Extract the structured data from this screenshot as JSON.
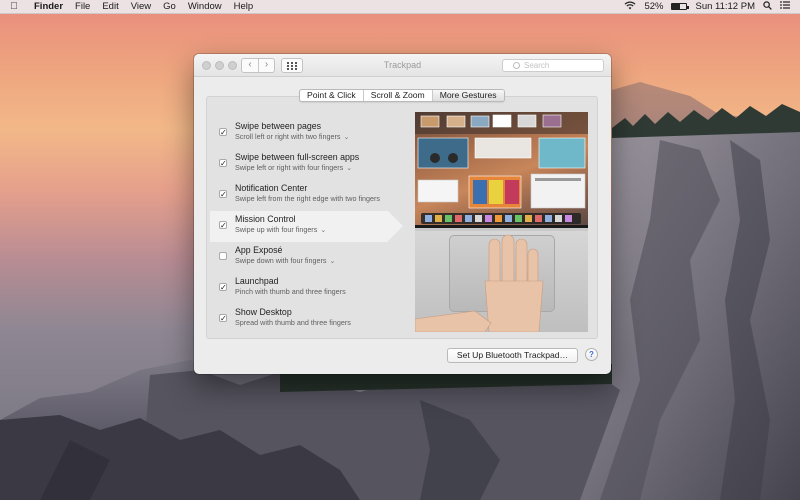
{
  "menubar": {
    "apple_icon": "apple-logo-icon",
    "app_name": "Finder",
    "menus": [
      "File",
      "Edit",
      "View",
      "Go",
      "Window",
      "Help"
    ],
    "battery_percent": "52%",
    "battery_level": 0.52,
    "clock": "Sun 11:12 PM"
  },
  "window": {
    "title": "Trackpad",
    "search_placeholder": "Search",
    "tabs": [
      {
        "label": "Point & Click",
        "active": false
      },
      {
        "label": "Scroll & Zoom",
        "active": false
      },
      {
        "label": "More Gestures",
        "active": true
      }
    ],
    "gestures": [
      {
        "title": "Swipe between pages",
        "subtitle": "Scroll left or right with two fingers",
        "has_menu": true,
        "checked": true,
        "selected": false
      },
      {
        "title": "Swipe between full-screen apps",
        "subtitle": "Swipe left or right with four fingers",
        "has_menu": true,
        "checked": true,
        "selected": false
      },
      {
        "title": "Notification Center",
        "subtitle": "Swipe left from the right edge with two fingers",
        "has_menu": false,
        "checked": true,
        "selected": false
      },
      {
        "title": "Mission Control",
        "subtitle": "Swipe up with four fingers",
        "has_menu": true,
        "checked": true,
        "selected": true
      },
      {
        "title": "App Exposé",
        "subtitle": "Swipe down with four fingers",
        "has_menu": true,
        "checked": false,
        "selected": false
      },
      {
        "title": "Launchpad",
        "subtitle": "Pinch with thumb and three fingers",
        "has_menu": false,
        "checked": true,
        "selected": false
      },
      {
        "title": "Show Desktop",
        "subtitle": "Spread with thumb and three fingers",
        "has_menu": false,
        "checked": true,
        "selected": false
      }
    ],
    "bluetooth_button": "Set Up Bluetooth Trackpad…",
    "help_button": "?"
  },
  "colors": {
    "accent": "#3a6fd8",
    "window_bg": "#ececec",
    "selected_row": "#f1f1f1"
  }
}
